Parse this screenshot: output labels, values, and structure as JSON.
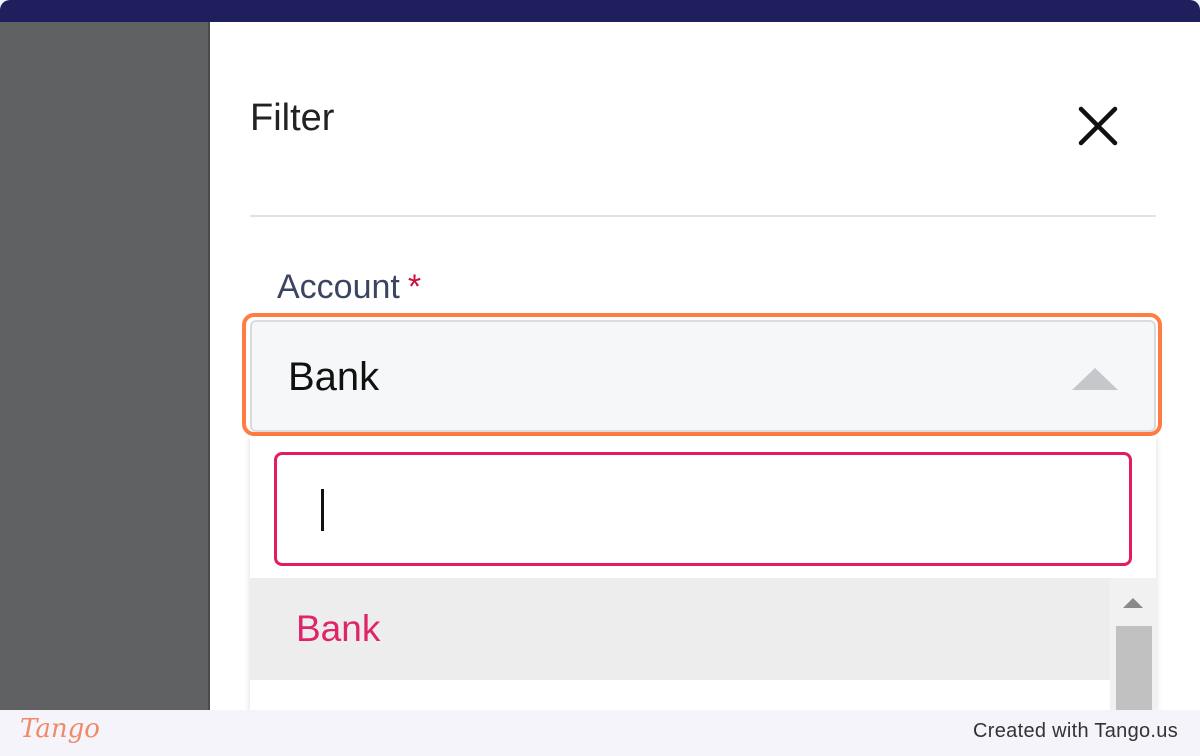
{
  "panel": {
    "title": "Filter",
    "close_icon": "close-icon"
  },
  "field": {
    "label": "Account",
    "required_marker": "*",
    "selected_value": "Bank",
    "caret_icon": "caret-up-icon"
  },
  "dropdown": {
    "search_value": "",
    "options": [
      {
        "label": "Bank",
        "highlighted": true
      }
    ]
  },
  "footer": {
    "logo": "Tango",
    "credit": "Created with Tango.us"
  },
  "colors": {
    "top_bar": "#1e1f5c",
    "highlight": "#ff7c44",
    "accent": "#e0246a",
    "required": "#c8103e"
  }
}
